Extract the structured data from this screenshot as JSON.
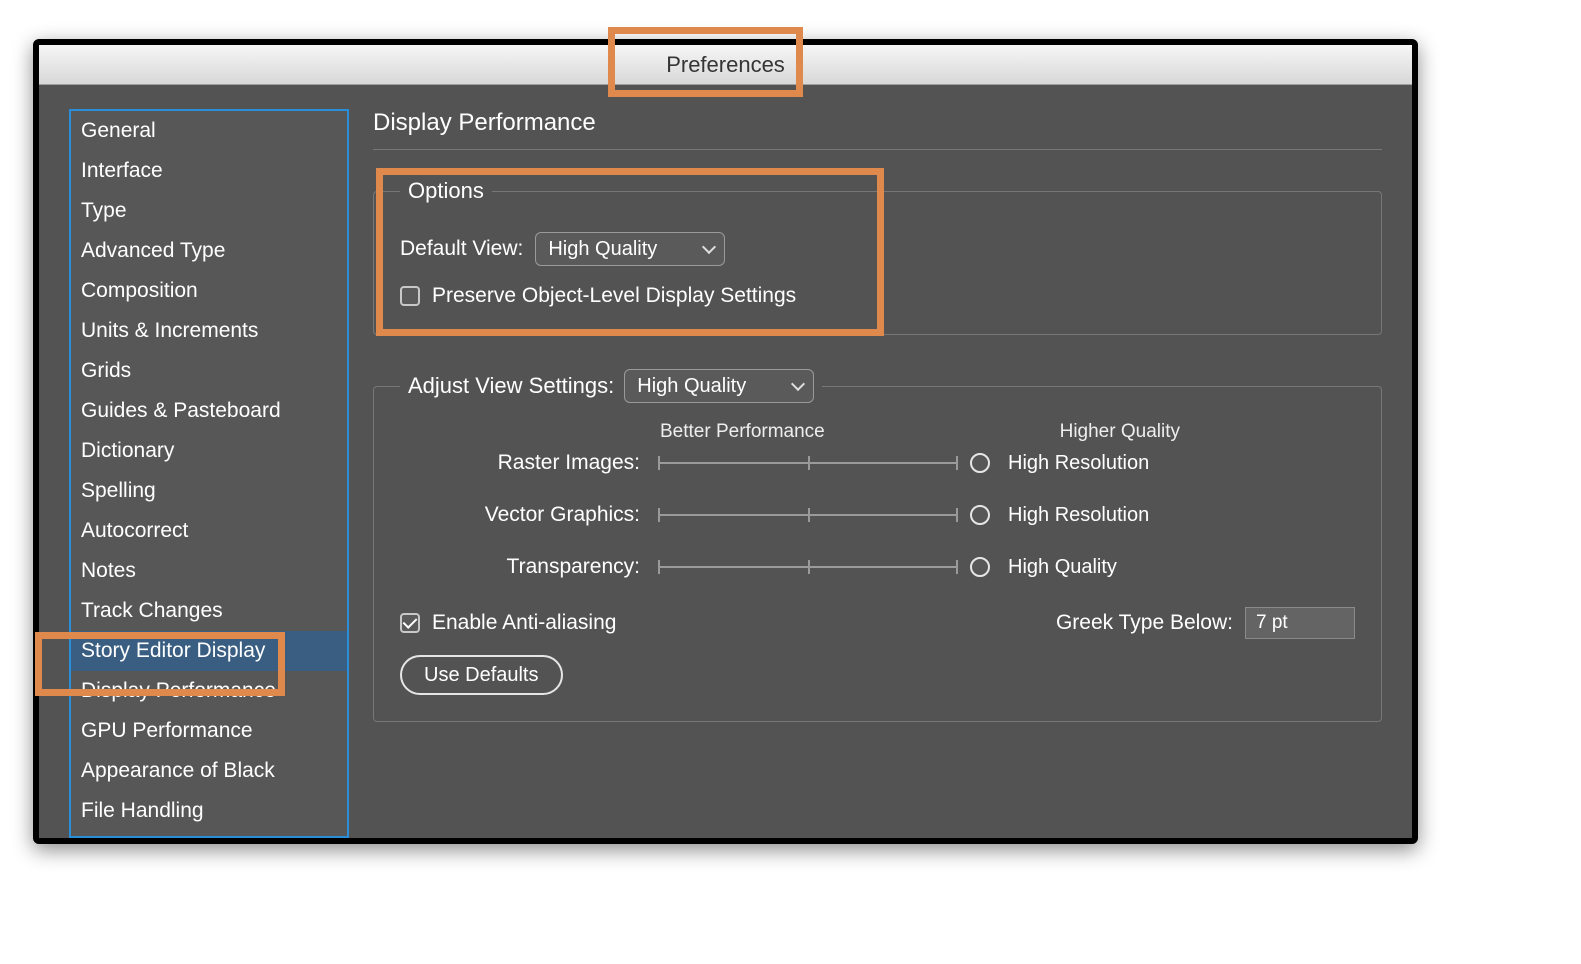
{
  "window_title": "Preferences",
  "page_title": "Display Performance",
  "sidebar": {
    "selected_index": 13,
    "items": [
      "General",
      "Interface",
      "Type",
      "Advanced Type",
      "Composition",
      "Units & Increments",
      "Grids",
      "Guides & Pasteboard",
      "Dictionary",
      "Spelling",
      "Autocorrect",
      "Notes",
      "Track Changes",
      "Story Editor Display",
      "Display Performance",
      "GPU Performance",
      "Appearance of Black",
      "File Handling"
    ]
  },
  "options": {
    "legend": "Options",
    "default_view_label": "Default View:",
    "default_view_value": "High Quality",
    "preserve_checkbox_label": "Preserve Object-Level Display Settings",
    "preserve_checkbox_checked": false
  },
  "adjust": {
    "legend_label": "Adjust View Settings:",
    "legend_value": "High Quality",
    "axis_left": "Better Performance",
    "axis_right": "Higher Quality",
    "sliders": [
      {
        "label": "Raster Images:",
        "value_label": "High Resolution"
      },
      {
        "label": "Vector Graphics:",
        "value_label": "High Resolution"
      },
      {
        "label": "Transparency:",
        "value_label": "High Quality"
      }
    ],
    "antialias_label": "Enable Anti-aliasing",
    "antialias_checked": true,
    "greek_label": "Greek Type Below:",
    "greek_value": "7 pt",
    "use_defaults_label": "Use Defaults"
  }
}
